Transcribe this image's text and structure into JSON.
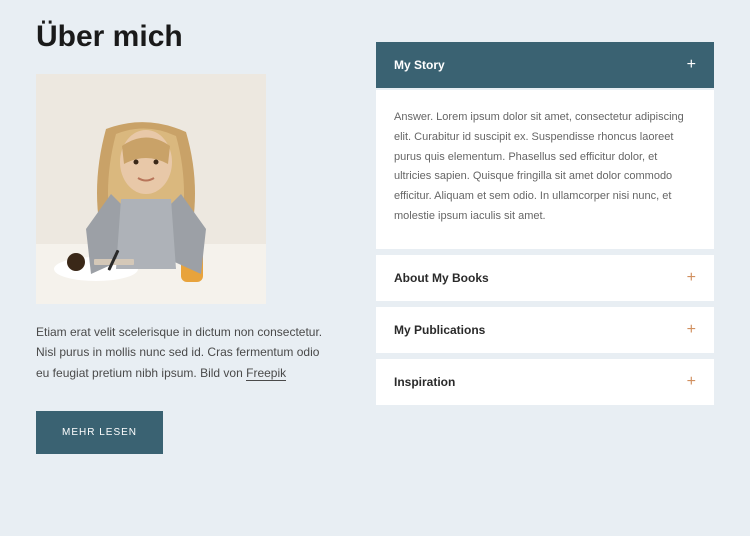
{
  "left": {
    "heading": "Über mich",
    "description_prefix": "Etiam erat velit scelerisque in dictum non consectetur. Nisl purus in mollis nunc sed id. Cras fermentum odio eu feugiat pretium nibh ipsum. Bild von ",
    "description_link": "Freepik",
    "button": "MEHR LESEN"
  },
  "accordion": [
    {
      "title": "My Story",
      "expanded": true,
      "body": "Answer. Lorem ipsum dolor sit amet, consectetur adipiscing elit. Curabitur id suscipit ex. Suspendisse rhoncus laoreet purus quis elementum. Phasellus sed efficitur dolor, et ultricies sapien. Quisque fringilla sit amet dolor commodo efficitur. Aliquam et sem odio. In ullamcorper nisi nunc, et molestie ipsum iaculis sit amet."
    },
    {
      "title": "About My Books",
      "expanded": false
    },
    {
      "title": "My Publications",
      "expanded": false
    },
    {
      "title": "Inspiration",
      "expanded": false
    }
  ]
}
